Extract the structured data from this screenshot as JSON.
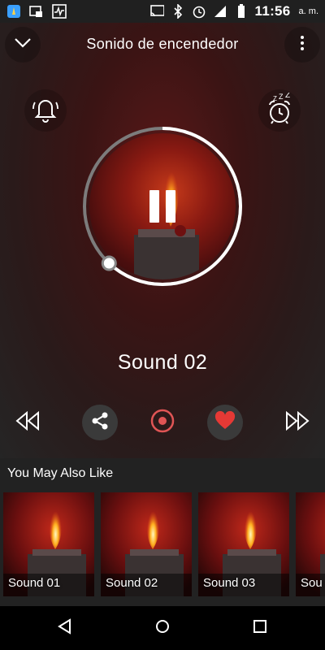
{
  "status_bar": {
    "time": "11:56",
    "ampm": "a. m."
  },
  "header": {
    "title": "Sonido de encendedor"
  },
  "player": {
    "track_title": "Sound 02",
    "progress": 0.62
  },
  "colors": {
    "accent_red": "#e53935",
    "ring": "#ffffff"
  },
  "suggestions": {
    "title": "You May Also Like",
    "items": [
      {
        "label": "Sound 01"
      },
      {
        "label": "Sound 02"
      },
      {
        "label": "Sound 03"
      },
      {
        "label": "Sou"
      }
    ]
  }
}
